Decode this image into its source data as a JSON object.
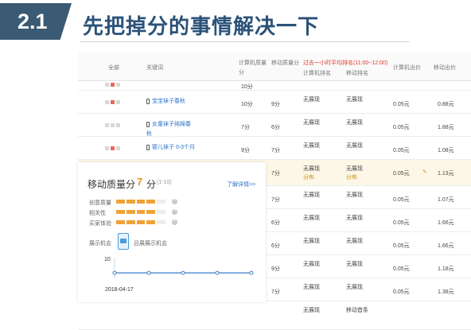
{
  "slide": {
    "number": "2.1",
    "title": "先把掉分的事情解决一下"
  },
  "table": {
    "headers": {
      "all": "全部",
      "keyword": "关键词",
      "pc_quality_1": "计算机质量",
      "pc_quality_2": "分",
      "mobile_quality_1": "移动质量分",
      "period_note": "过去一小时平均排名(11:00~12:00)",
      "pc_rank": "计算机排名",
      "mobile_rank": "移动排名",
      "pc_bid": "计算机出价",
      "mobile_bid": "移动出价"
    },
    "rows": [
      {
        "status": [
          false,
          true,
          false
        ],
        "keyword": "",
        "pc_q": "10分",
        "m_q": "",
        "pc_rank": "",
        "m_rank": "",
        "pc_bid": "",
        "m_bid": ""
      },
      {
        "status": [
          false,
          true,
          false
        ],
        "keyword": "宝宝袜子春秋",
        "pc_q": "10分",
        "m_q": "9分",
        "pc_rank": "无展现",
        "m_rank": "无展现",
        "pc_bid": "0.05元",
        "m_bid": "0.88元"
      },
      {
        "status": [
          false,
          false,
          false
        ],
        "keyword": "女童袜子纯棉春秋",
        "pc_q": "7分",
        "m_q": "6分",
        "pc_rank": "无展现",
        "m_rank": "无展现",
        "pc_bid": "0.05元",
        "m_bid": "1.88元"
      },
      {
        "status": [
          false,
          true,
          false
        ],
        "keyword": "婴儿袜子 0-3个月",
        "pc_q": "9分",
        "m_q": "7分",
        "pc_rank": "无展现",
        "m_rank": "无展现",
        "pc_bid": "0.05元",
        "m_bid": "1.08元"
      },
      {
        "status": [],
        "keyword": "",
        "pc_q": "",
        "m_q": "7分",
        "pc_rank": "无展现",
        "pc_rank_sub": "分布",
        "m_rank": "无展现",
        "m_rank_sub": "分布",
        "pc_bid": "0.05元",
        "m_bid": "1.13元"
      },
      {
        "status": [],
        "keyword": "",
        "pc_q": "",
        "m_q": "7分",
        "pc_rank": "无展现",
        "m_rank": "无展现",
        "pc_bid": "0.05元",
        "m_bid": "1.07元"
      },
      {
        "status": [],
        "keyword": "",
        "pc_q": "",
        "m_q": "6分",
        "pc_rank": "无展现",
        "m_rank": "无展现",
        "pc_bid": "0.05元",
        "m_bid": "1.66元"
      },
      {
        "status": [],
        "keyword": "",
        "pc_q": "",
        "m_q": "6分",
        "pc_rank": "无展现",
        "m_rank": "无展现",
        "pc_bid": "0.05元",
        "m_bid": "1.66元"
      },
      {
        "status": [],
        "keyword": "",
        "pc_q": "",
        "m_q": "9分",
        "pc_rank": "无展现",
        "m_rank": "无展现",
        "pc_bid": "0.05元",
        "m_bid": "1.18元"
      },
      {
        "status": [],
        "keyword": "",
        "pc_q": "",
        "m_q": "7分",
        "pc_rank": "无展现",
        "m_rank": "无展现",
        "pc_bid": "0.05元",
        "m_bid": "1.38元"
      },
      {
        "status": [],
        "keyword": "",
        "pc_q": "",
        "m_q": "",
        "pc_rank": "无展现",
        "m_rank": "移动首条",
        "pc_bid": "",
        "m_bid": ""
      }
    ]
  },
  "quality_card": {
    "title": "移动质量分",
    "score": "7",
    "unit": "分",
    "range": "(1-10)",
    "detail_link": "了解详情>>",
    "metrics": [
      {
        "label": "创意质量",
        "level": 4,
        "max": 5
      },
      {
        "label": "相关性",
        "level": 4,
        "max": 5
      },
      {
        "label": "买家体验",
        "level": 4,
        "max": 5
      }
    ],
    "display_label": "展示机会",
    "display_value": "且展展示机会",
    "trend": {
      "y_tick": "10",
      "date": "2018-04-17",
      "values": [
        7,
        7,
        7,
        7,
        7
      ]
    }
  },
  "colors": {
    "accent": "#3b5a73",
    "title": "#2b5278",
    "score": "#e8931d",
    "link": "#2d73c9",
    "highlight": "#fdf7e8"
  }
}
